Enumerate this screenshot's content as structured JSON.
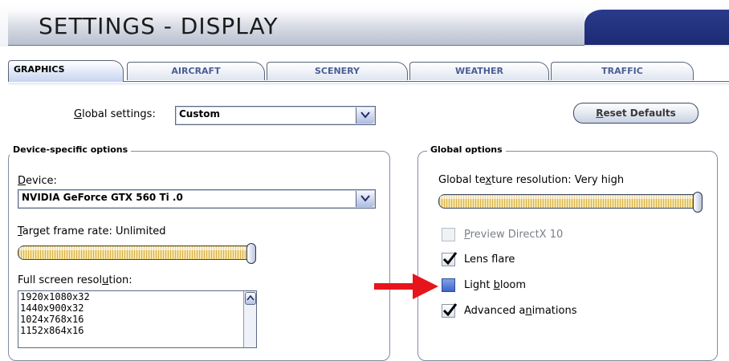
{
  "header": {
    "title": "SETTINGS - DISPLAY"
  },
  "tabs": [
    {
      "label": "GRAPHICS",
      "active": true
    },
    {
      "label": "AIRCRAFT",
      "active": false
    },
    {
      "label": "SCENERY",
      "active": false
    },
    {
      "label": "WEATHER",
      "active": false
    },
    {
      "label": "TRAFFIC",
      "active": false
    }
  ],
  "global_settings": {
    "label_pre": "",
    "label_u": "G",
    "label_post": "lobal settings:",
    "value": "Custom"
  },
  "reset_button": {
    "label_u": "R",
    "label_post": "eset Defaults"
  },
  "device_group": {
    "title": "Device-specific options",
    "device_label_u": "D",
    "device_label_post": "evice:",
    "device_value": "NVIDIA GeForce GTX 560 Ti  .0",
    "frame_rate_label_u": "T",
    "frame_rate_label_post": "arget frame rate: Unlimited",
    "frame_rate_level": 1.0,
    "resolution_label_pre": "Full screen resol",
    "resolution_label_u": "u",
    "resolution_label_post": "tion:",
    "resolutions": [
      "1920x1080x32",
      "1440x900x32",
      "1024x768x16",
      "1152x864x16"
    ]
  },
  "global_group": {
    "title": "Global options",
    "texture_label_pre": "Global te",
    "texture_label_u": "x",
    "texture_label_post": "ture resolution: Very high",
    "texture_level": 1.0,
    "options": [
      {
        "pre": "",
        "u": "P",
        "post": "review DirectX 10",
        "state": "disabled"
      },
      {
        "pre": "Lens f",
        "u": "l",
        "post": "are",
        "state": "checked"
      },
      {
        "pre": "Light ",
        "u": "b",
        "post": "loom",
        "state": "highlighted"
      },
      {
        "pre": "Advanced a",
        "u": "n",
        "post": "imations",
        "state": "checked"
      }
    ]
  },
  "colors": {
    "accent": "#1d2b73",
    "annotation_arrow": "#e8141c",
    "slider_fill": "#e9cf7f"
  }
}
